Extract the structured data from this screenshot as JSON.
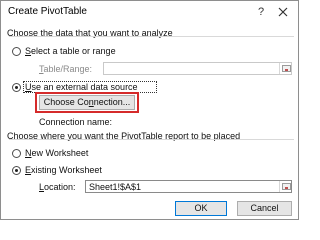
{
  "dialog": {
    "title": "Create PivotTable",
    "help_glyph": "?",
    "close_glyph": "✕"
  },
  "section_data": {
    "heading": "Choose the data that you want to analyze",
    "select_range": {
      "label_prefix": "S",
      "label_rest": "elect a table or range",
      "checked": false
    },
    "table_range": {
      "label_prefix": "T",
      "label_rest": "able/Range:",
      "value": ""
    },
    "external_source": {
      "label_prefix": "U",
      "label_rest": "se an external data source",
      "checked": true
    },
    "choose_connection": {
      "label_pre": "Choose Co",
      "label_u": "n",
      "label_post": "nection..."
    },
    "connection_name": {
      "label": "Connection name:"
    }
  },
  "section_place": {
    "heading": "Choose where you want the PivotTable report to be placed",
    "new_worksheet": {
      "label_prefix": "N",
      "label_rest": "ew Worksheet",
      "checked": false
    },
    "existing_worksheet": {
      "label_prefix": "E",
      "label_rest": "xisting Worksheet",
      "checked": true
    },
    "location": {
      "label_prefix": "L",
      "label_rest": "ocation:",
      "value": "Sheet1!$A$1"
    }
  },
  "footer": {
    "ok_label": "OK",
    "cancel_label": "Cancel"
  },
  "colors": {
    "highlight": "#d52b2b",
    "accent": "#0078d7"
  }
}
